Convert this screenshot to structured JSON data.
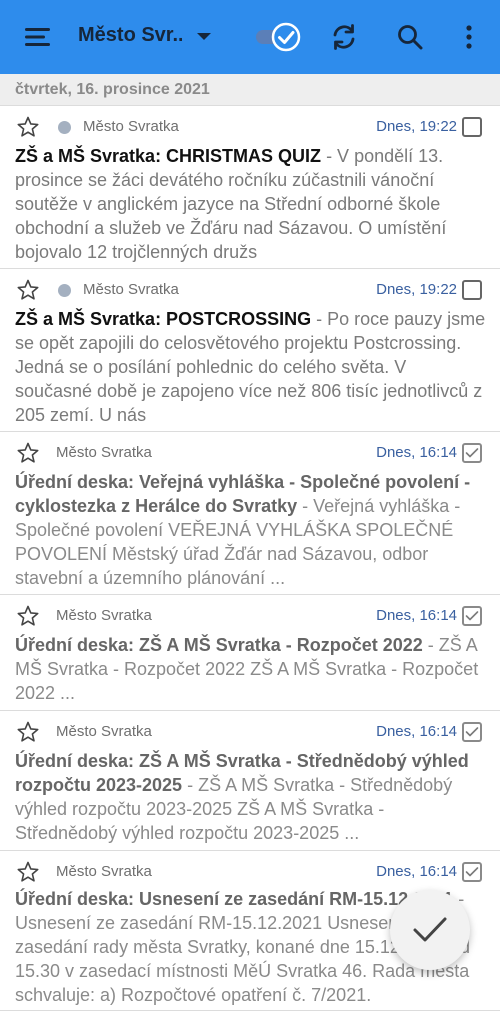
{
  "appbar": {
    "title": "Město Svr...",
    "colors": {
      "background": "#2e8cec",
      "foreground": "#16263a"
    },
    "icons": [
      "menu-icon",
      "dropdown-arrow-icon",
      "toggle-check-icon",
      "refresh-icon",
      "search-icon",
      "more-vert-icon"
    ]
  },
  "date_header": "čtvrtek, 16. prosince 2021",
  "items": [
    {
      "source": "Město Svratka",
      "time": "Dnes, 19:22",
      "unread": true,
      "checked": false,
      "title": "ZŠ a MŠ Svratka: CHRISTMAS QUIZ",
      "snippet": " - V pondělí 13. prosince se žáci devátého ročníku zúčastnili vánoční soutěže v anglickém jazyce na Střední odborné škole obchodní a služeb ve Žďáru nad Sázavou. O umístění bojovalo 12 trojčlenných družs"
    },
    {
      "source": "Město Svratka",
      "time": "Dnes, 19:22",
      "unread": true,
      "checked": false,
      "title": "ZŠ a MŠ Svratka: POSTCROSSING",
      "snippet": " - Po roce pauzy jsme se opět zapojili do celosvětového projektu Postcrossing. Jedná se o posílání pohlednic do celého světa. V současné době je zapojeno více než 806 tisíc jednotlivců z 205 zemí. U nás"
    },
    {
      "source": "Město Svratka",
      "time": "Dnes, 16:14",
      "unread": false,
      "checked": true,
      "title": "Úřední deska: Veřejná vyhláška - Společné povolení - cyklostezka z Herálce do Svratky",
      "snippet": " - Veřejná vyhláška - Společné povolení VEŘEJNÁ VYHLÁŠKA SPOLEČNÉ POVOLENÍ Městský úřad Žďár nad Sázavou, odbor stavební a územního plánování ..."
    },
    {
      "source": "Město Svratka",
      "time": "Dnes, 16:14",
      "unread": false,
      "checked": true,
      "title": "Úřední deska: ZŠ A MŠ Svratka - Rozpočet 2022",
      "snippet": " - ZŠ A MŠ Svratka - Rozpočet 2022 ZŠ A MŠ Svratka - Rozpočet 2022 ..."
    },
    {
      "source": "Město Svratka",
      "time": "Dnes, 16:14",
      "unread": false,
      "checked": true,
      "title": "Úřední deska: ZŠ A MŠ Svratka - Střednědobý výhled rozpočtu 2023-2025",
      "snippet": " - ZŠ A MŠ Svratka - Střednědobý výhled rozpočtu 2023-2025 ZŠ A MŠ Svratka - Střednědobý výhled rozpočtu 2023-2025 ..."
    },
    {
      "source": "Město Svratka",
      "time": "Dnes, 16:14",
      "unread": false,
      "checked": true,
      "title": "Úřední deska: Usnesení ze zasedání RM-15.12.2021",
      "snippet": " - Usnesení ze zasedání RM-15.12.2021 Usnesení ze zasedání rady města Svratky, konané dne 15.12.2021 od 15.30 v zasedací místnosti MěÚ Svratka 46. Rada města schvaluje: a) Rozpočtové opatření č. 7/2021."
    }
  ],
  "fab_icon": "checkmark-icon"
}
